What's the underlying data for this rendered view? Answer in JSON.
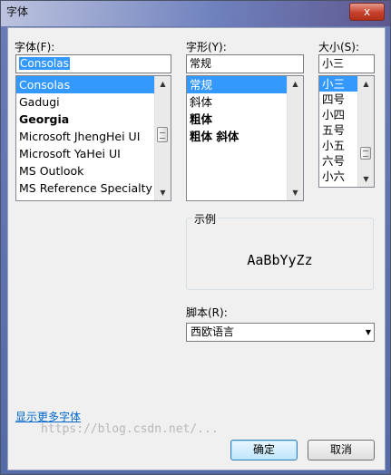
{
  "window": {
    "title": "字体",
    "close_label": "x"
  },
  "font": {
    "label": "字体(F):",
    "value": "Consolas",
    "items": [
      "Consolas",
      "Gadugi",
      "Georgia",
      "Microsoft JhengHei UI",
      "Microsoft YaHei UI",
      "MS Outlook",
      "MS Reference Specialty"
    ]
  },
  "style": {
    "label": "字形(Y):",
    "value": "常规",
    "items": [
      "常规",
      "斜体",
      "粗体",
      "粗体 斜体"
    ]
  },
  "size": {
    "label": "大小(S):",
    "value": "小三",
    "items": [
      "小三",
      "四号",
      "小四",
      "五号",
      "小五",
      "六号",
      "小六"
    ]
  },
  "sample": {
    "label": "示例",
    "text": "AaBbYyZz"
  },
  "script": {
    "label": "脚本(R):",
    "value": "西欧语言"
  },
  "more_fonts_link": "显示更多字体",
  "buttons": {
    "ok": "确定",
    "cancel": "取消"
  },
  "watermark": "https://blog.csdn.net/...",
  "icons": {
    "up": "▲",
    "down": "▼",
    "dropdown": "▼"
  }
}
